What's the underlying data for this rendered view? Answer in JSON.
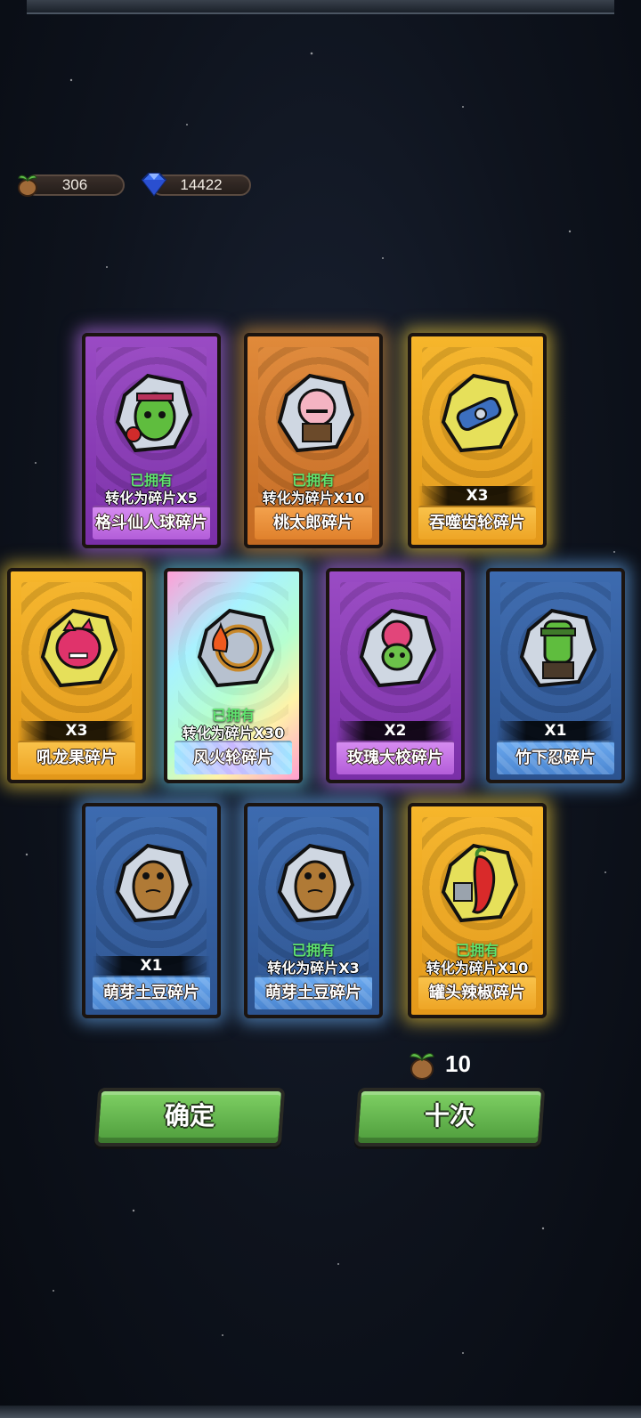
{
  "resources": {
    "seeds": "306",
    "gems": "14422"
  },
  "cards": [
    {
      "name": "格斗仙人球碎片",
      "status": "已拥有",
      "detail": "转化为碎片X5",
      "rarity_color": "#9a4bc4"
    },
    {
      "name": "桃太郎碎片",
      "status": "已拥有",
      "detail": "转化为碎片X10",
      "rarity_color": "#e08a3a"
    },
    {
      "name": "吞噬齿轮碎片",
      "status": "",
      "detail": "X3",
      "rarity_color": "#f6b62b"
    },
    {
      "name": "吼龙果碎片",
      "status": "",
      "detail": "X3",
      "rarity_color": "#f6b62b"
    },
    {
      "name": "风火轮碎片",
      "status": "已拥有",
      "detail": "转化为碎片X30",
      "rarity_color": "#a8f2ff"
    },
    {
      "name": "玫瑰大校碎片",
      "status": "",
      "detail": "X2",
      "rarity_color": "#9a4bc4"
    },
    {
      "name": "竹下忍碎片",
      "status": "",
      "detail": "X1",
      "rarity_color": "#3d6bb0"
    },
    {
      "name": "萌芽土豆碎片",
      "status": "",
      "detail": "X1",
      "rarity_color": "#3d6bb0"
    },
    {
      "name": "萌芽土豆碎片",
      "status": "已拥有",
      "detail": "转化为碎片X3",
      "rarity_color": "#3d6bb0"
    },
    {
      "name": "罐头辣椒碎片",
      "status": "已拥有",
      "detail": "转化为碎片X10",
      "rarity_color": "#f6b62b"
    }
  ],
  "draw_cost": "10",
  "buttons": {
    "confirm": "确定",
    "ten_draw": "十次"
  }
}
